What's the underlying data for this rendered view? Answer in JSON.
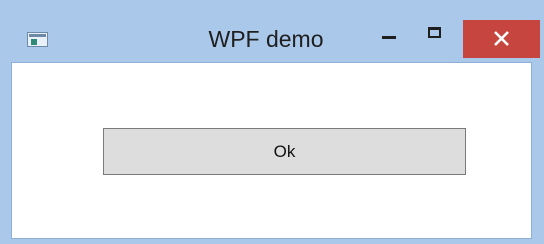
{
  "window": {
    "title": "WPF demo",
    "icons": {
      "app": "window-app-icon",
      "minimize": "minimize-icon",
      "maximize": "maximize-icon",
      "close": "close-icon"
    },
    "colors": {
      "frame": "#a9c8ea",
      "close": "#c7453f",
      "client": "#ffffff"
    }
  },
  "content": {
    "ok_label": "Ok"
  }
}
